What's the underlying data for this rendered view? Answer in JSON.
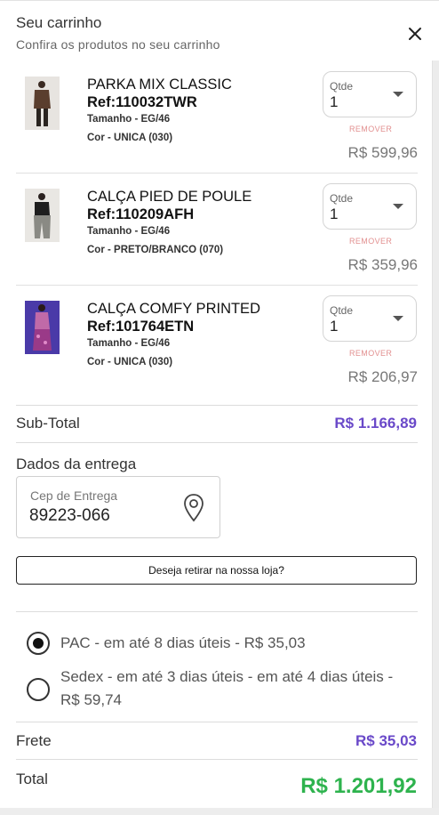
{
  "header": {
    "title": "Seu carrinho",
    "subtitle": "Confira os produtos no seu carrinho",
    "close_icon": "close-icon"
  },
  "items": [
    {
      "name": "PARKA MIX CLASSIC",
      "ref": "Ref:110032TWR",
      "size": "Tamanho - EG/46",
      "color": "Cor - UNICA (030)",
      "qty_label": "Qtde",
      "qty": "1",
      "remove": "REMOVER",
      "price": "R$ 599,96"
    },
    {
      "name": "CALÇA PIED DE POULE",
      "ref": "Ref:110209AFH",
      "size": "Tamanho - EG/46",
      "color": "Cor - PRETO/BRANCO (070)",
      "qty_label": "Qtde",
      "qty": "1",
      "remove": "REMOVER",
      "price": "R$ 359,96"
    },
    {
      "name": "CALÇA COMFY PRINTED",
      "ref": "Ref:101764ETN",
      "size": "Tamanho - EG/46",
      "color": "Cor - UNICA (030)",
      "qty_label": "Qtde",
      "qty": "1",
      "remove": "REMOVER",
      "price": "R$ 206,97"
    }
  ],
  "subtotal": {
    "label": "Sub-Total",
    "value": "R$ 1.166,89"
  },
  "delivery": {
    "label": "Dados da entrega",
    "cep_label": "Cep de Entrega",
    "cep_value": "89223-066",
    "pickup_button": "Deseja retirar na nossa loja?"
  },
  "shipping_options": [
    {
      "line1": "PAC - em até 8 dias úteis - R$ 35,03",
      "line2": "",
      "selected": true
    },
    {
      "line1": "Sedex - em até 3 dias úteis - em até 4 dias úteis -",
      "line2": "R$ 59,74",
      "selected": false
    }
  ],
  "frete": {
    "label": "Frete",
    "value": "R$ 35,03"
  },
  "total": {
    "label": "Total",
    "value": "R$ 1.201,92"
  },
  "colors": {
    "accent_purple": "#6a49c9",
    "total_green": "#2eb34e",
    "remove_pink": "#e29090"
  }
}
